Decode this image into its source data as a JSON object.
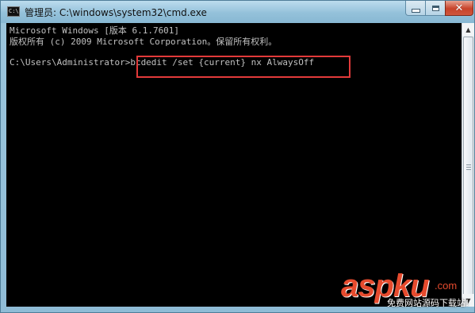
{
  "window": {
    "title": "管理员: C:\\windows\\system32\\cmd.exe",
    "app_icon": "C:\\",
    "controls": {
      "minimize_icon": "minimize-icon",
      "maximize_icon": "maximize-icon",
      "close_icon": "close-icon",
      "close_glyph": "✕"
    }
  },
  "console": {
    "lines": [
      "Microsoft Windows [版本 6.1.7601]",
      "版权所有 (c) 2009 Microsoft Corporation。保留所有权利。",
      "C:\\Users\\Administrator>bcdedit /set {current} nx AlwaysOff"
    ],
    "highlight_color": "#e23a3a",
    "background": "#000000",
    "text_color": "#c0c0c0"
  },
  "scrollbar": {
    "up_arrow": "▲",
    "down_arrow": "▼"
  },
  "watermark": {
    "brand": "aspku",
    "tld": ".com",
    "subtitle": "免费网站源码下载站!",
    "color": "#e64b2e"
  }
}
